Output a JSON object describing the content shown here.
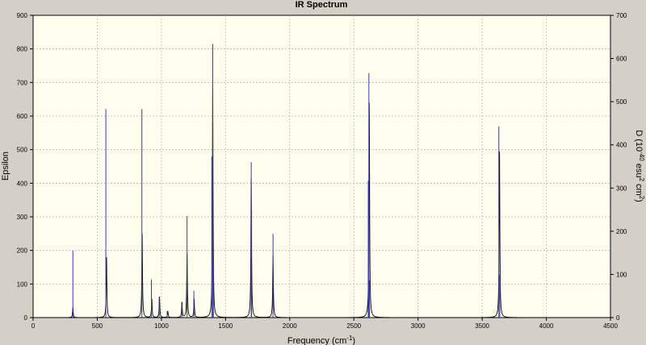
{
  "chart_data": {
    "type": "line",
    "title": "IR Spectrum",
    "xlabel": "Frequency (cm",
    "xlabel_sup": "-1",
    "xlabel_end": ")",
    "ylabel": "Epsilon",
    "ylabel_right": "D (10",
    "ylabel_right_sup1": "-40",
    "ylabel_right_mid": " esu",
    "ylabel_right_sup2": "2",
    "ylabel_right_mid2": " cm",
    "ylabel_right_sup3": "2",
    "ylabel_right_end": ")",
    "xlim": [
      0,
      4500
    ],
    "ylim": [
      0,
      900
    ],
    "ylim_right": [
      0,
      700
    ],
    "x_ticks": [
      0,
      500,
      1000,
      1500,
      2000,
      2500,
      3000,
      3500,
      4000,
      4500
    ],
    "y_ticks": [
      0,
      100,
      200,
      300,
      400,
      500,
      600,
      700,
      800,
      900
    ],
    "y_ticks_right": [
      0,
      100,
      200,
      300,
      400,
      500,
      600,
      700
    ],
    "grid": true,
    "line_range": [
      170,
      4140
    ],
    "series": [
      {
        "kind": "spectrum-curve",
        "peaks": [
          {
            "x": 310,
            "epsilon": 30
          },
          {
            "x": 572,
            "epsilon": 180
          },
          {
            "x": 850,
            "epsilon": 250
          },
          {
            "x": 925,
            "epsilon": 55
          },
          {
            "x": 985,
            "epsilon": 62
          },
          {
            "x": 1050,
            "epsilon": 18
          },
          {
            "x": 1160,
            "epsilon": 45
          },
          {
            "x": 1200,
            "epsilon": 190
          },
          {
            "x": 1255,
            "epsilon": 55
          },
          {
            "x": 1400,
            "epsilon": 690
          },
          {
            "x": 1700,
            "epsilon": 415
          },
          {
            "x": 1870,
            "epsilon": 185
          },
          {
            "x": 2620,
            "epsilon": 640
          },
          {
            "x": 3635,
            "epsilon": 495
          }
        ]
      },
      {
        "kind": "intensity-sticks",
        "sticks": [
          {
            "x": 310,
            "d": 155
          },
          {
            "x": 567,
            "d": 483
          },
          {
            "x": 848,
            "d": 483
          },
          {
            "x": 922,
            "d": 88
          },
          {
            "x": 983,
            "d": 47
          },
          {
            "x": 1045,
            "d": 15
          },
          {
            "x": 1160,
            "d": 30
          },
          {
            "x": 1200,
            "d": 235
          },
          {
            "x": 1253,
            "d": 62
          },
          {
            "x": 1393,
            "d": 373
          },
          {
            "x": 1400,
            "d": 634
          },
          {
            "x": 1405,
            "d": 124
          },
          {
            "x": 1700,
            "d": 360
          },
          {
            "x": 1703,
            "d": 250
          },
          {
            "x": 1870,
            "d": 194
          },
          {
            "x": 2612,
            "d": 317
          },
          {
            "x": 2617,
            "d": 566
          },
          {
            "x": 2622,
            "d": 87
          },
          {
            "x": 3630,
            "d": 443
          },
          {
            "x": 3637,
            "d": 100
          }
        ]
      }
    ]
  }
}
